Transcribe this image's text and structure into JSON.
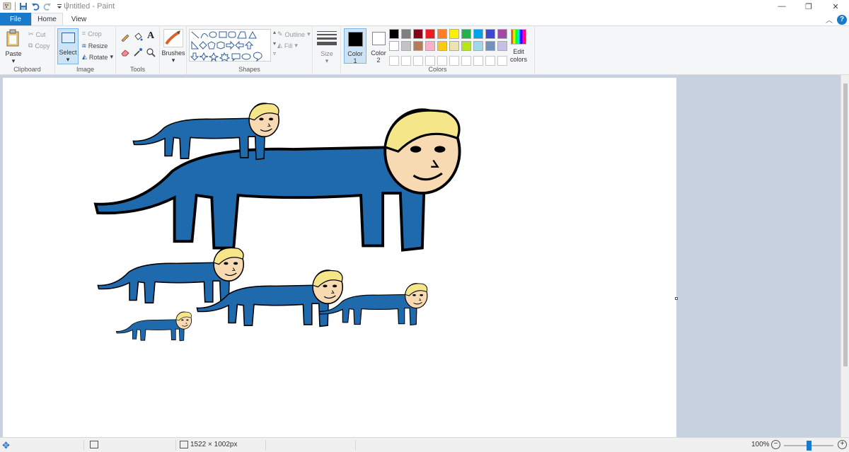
{
  "window": {
    "title": "Untitled - Paint",
    "controls": {
      "minimize": "—",
      "restore": "❐",
      "close": "✕"
    }
  },
  "tabs": {
    "file": "File",
    "home": "Home",
    "view": "View",
    "help": "?"
  },
  "ribbon": {
    "clipboard": {
      "paste": "Paste",
      "cut": "Cut",
      "copy": "Copy",
      "label": "Clipboard"
    },
    "image": {
      "select": "Select",
      "crop": "Crop",
      "resize": "Resize",
      "rotate": "Rotate",
      "label": "Image"
    },
    "tools": {
      "label": "Tools"
    },
    "brushes": {
      "label": "Brushes"
    },
    "shapes": {
      "outline": "Outline",
      "fill": "Fill",
      "label": "Shapes"
    },
    "size": {
      "label": "Size"
    },
    "colors": {
      "color1_label": "Color",
      "color1_num": "1",
      "color2_label": "Color",
      "color2_num": "2",
      "edit": "Edit colors",
      "label": "Colors",
      "color1": "#000000",
      "color2": "#ffffff",
      "row1": [
        "#000000",
        "#7f7f7f",
        "#880015",
        "#ed1c24",
        "#ff7f27",
        "#fff200",
        "#22b14c",
        "#00a2e8",
        "#3f48cc",
        "#a349a4"
      ],
      "row2": [
        "#ffffff",
        "#c3c3c3",
        "#b97a57",
        "#ffaec9",
        "#ffc90e",
        "#efe4b0",
        "#b5e61d",
        "#99d9ea",
        "#7092be",
        "#c8bfe7"
      ]
    }
  },
  "status": {
    "dimensions": "1522 × 1002px",
    "zoom": "100%"
  },
  "canvas_image": {
    "description_icon": "cat-men-image",
    "body_color": "#1f6aad",
    "skin_color": "#f7d9b2",
    "hair_color": "#f5e68a"
  }
}
